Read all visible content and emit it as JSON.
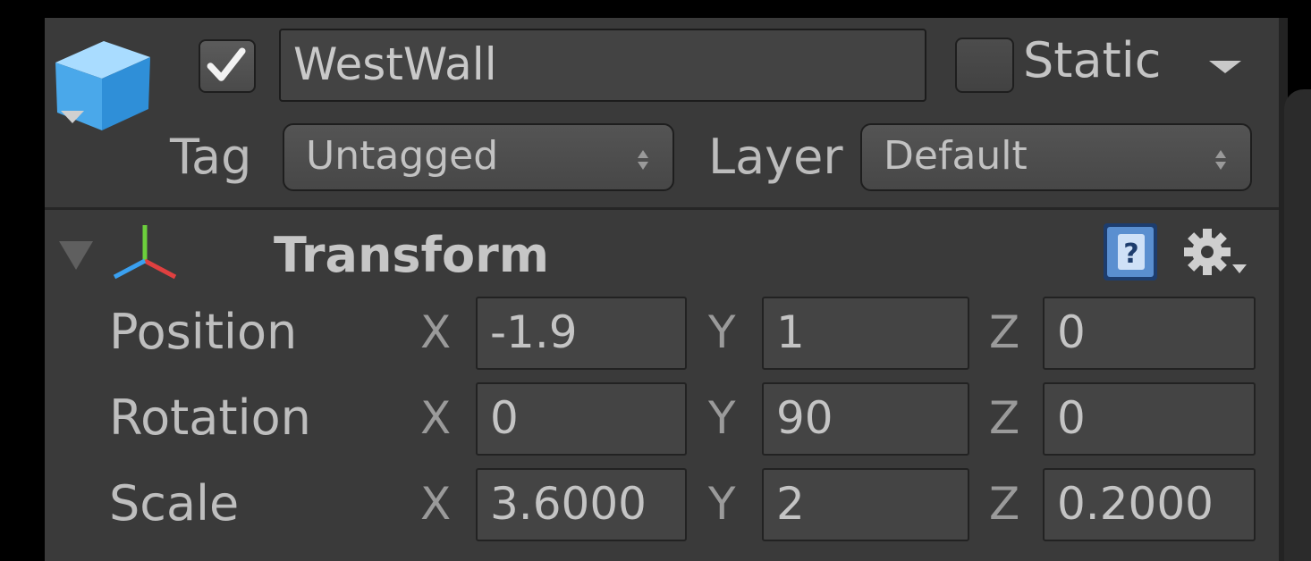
{
  "game_object": {
    "active": true,
    "name": "WestWall",
    "static_label": "Static",
    "static_checked": false,
    "tag_label": "Tag",
    "tag_value": "Untagged",
    "layer_label": "Layer",
    "layer_value": "Default",
    "icon": "cube-icon"
  },
  "transform": {
    "title": "Transform",
    "icons": [
      "axis-gizmo-icon",
      "help-book-icon",
      "gear-icon",
      "foldout-triangle-icon"
    ],
    "axis_letters": {
      "x": "X",
      "y": "Y",
      "z": "Z"
    },
    "rows": [
      {
        "label": "Position",
        "x": "-1.9",
        "y": "1",
        "z": "0"
      },
      {
        "label": "Rotation",
        "x": "0",
        "y": "90",
        "z": "0"
      },
      {
        "label": "Scale",
        "x": "3.6000",
        "y": "2",
        "z": "0.2000"
      }
    ]
  },
  "colors": {
    "panel_bg": "#3a3a3a",
    "field_bg": "#444444",
    "text": "#c4c4c4",
    "cube_blue": "#5ab4ee"
  }
}
